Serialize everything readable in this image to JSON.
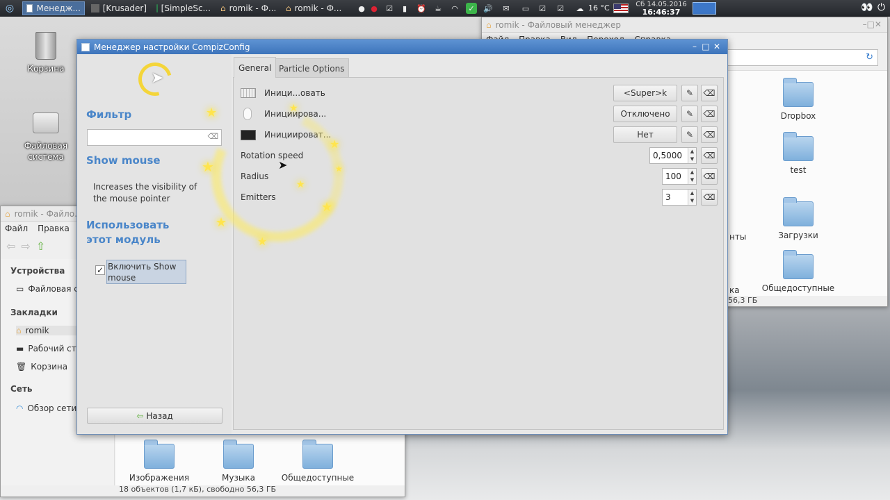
{
  "taskbar": {
    "items": [
      {
        "label": "Менедж...",
        "active": true
      },
      {
        "label": "[Krusader]"
      },
      {
        "label": "[SimpleSc..."
      },
      {
        "label": "romik - Ф..."
      },
      {
        "label": "romik - Ф..."
      }
    ],
    "weather": "16 °C",
    "date": "Сб 14.05.2016",
    "time": "16:46:37"
  },
  "desktop": {
    "icons": [
      {
        "label": "Корзина"
      },
      {
        "label": "Файловая система"
      }
    ]
  },
  "bg_window_right": {
    "title": "romik - Файловый менеджер",
    "menu": [
      "Файл",
      "Правка",
      "Вид",
      "Переход",
      "Справка"
    ],
    "folders": [
      "Dropbox",
      "test",
      "Загрузки",
      "Общедоступные"
    ],
    "partial_left": [
      "нты",
      "ка"
    ],
    "status": "56,3 ГБ"
  },
  "bg_window_left": {
    "title": "romik - Файло...",
    "menu": [
      "Файл",
      "Правка"
    ],
    "sections": {
      "devices": "Устройства",
      "bookmarks": "Закладки",
      "network": "Сеть"
    },
    "device_items": [
      "Файловая с..."
    ],
    "bookmark_items": [
      "romik",
      "Рабочий ст...",
      "Корзина"
    ],
    "network_items": [
      "Обзор сети"
    ],
    "folders": [
      "Изображения",
      "Музыка",
      "Общедоступные"
    ],
    "status": "18 объектов (1,7 кБ), свободно 56,3 ГБ"
  },
  "compiz": {
    "title": "Менеджер настройки CompizConfig",
    "filter_label": "Фильтр",
    "filter_value": "",
    "plugin_name": "Show mouse",
    "plugin_desc": "Increases the visibility of the mouse pointer",
    "use_module_label": "Использовать этот модуль",
    "enable_checkbox_label": "Включить Show mouse",
    "enable_checked": true,
    "back_label": "Назад",
    "tabs": [
      "General",
      "Particle Options"
    ],
    "rows": [
      {
        "label": "Иници...овать",
        "value": "<Super>k",
        "kind": "key"
      },
      {
        "label": "Инициирова...",
        "value": "Отключено",
        "kind": "button"
      },
      {
        "label": "Инициироват...",
        "value": "Нет",
        "kind": "edge"
      },
      {
        "label": "Rotation speed",
        "value": "0,5000",
        "kind": "spin"
      },
      {
        "label": "Radius",
        "value": "100",
        "kind": "spin"
      },
      {
        "label": "Emitters",
        "value": "3",
        "kind": "spin"
      }
    ]
  },
  "colors": {
    "accent": "#4a86c9",
    "titlebar": "#4a80c4"
  }
}
